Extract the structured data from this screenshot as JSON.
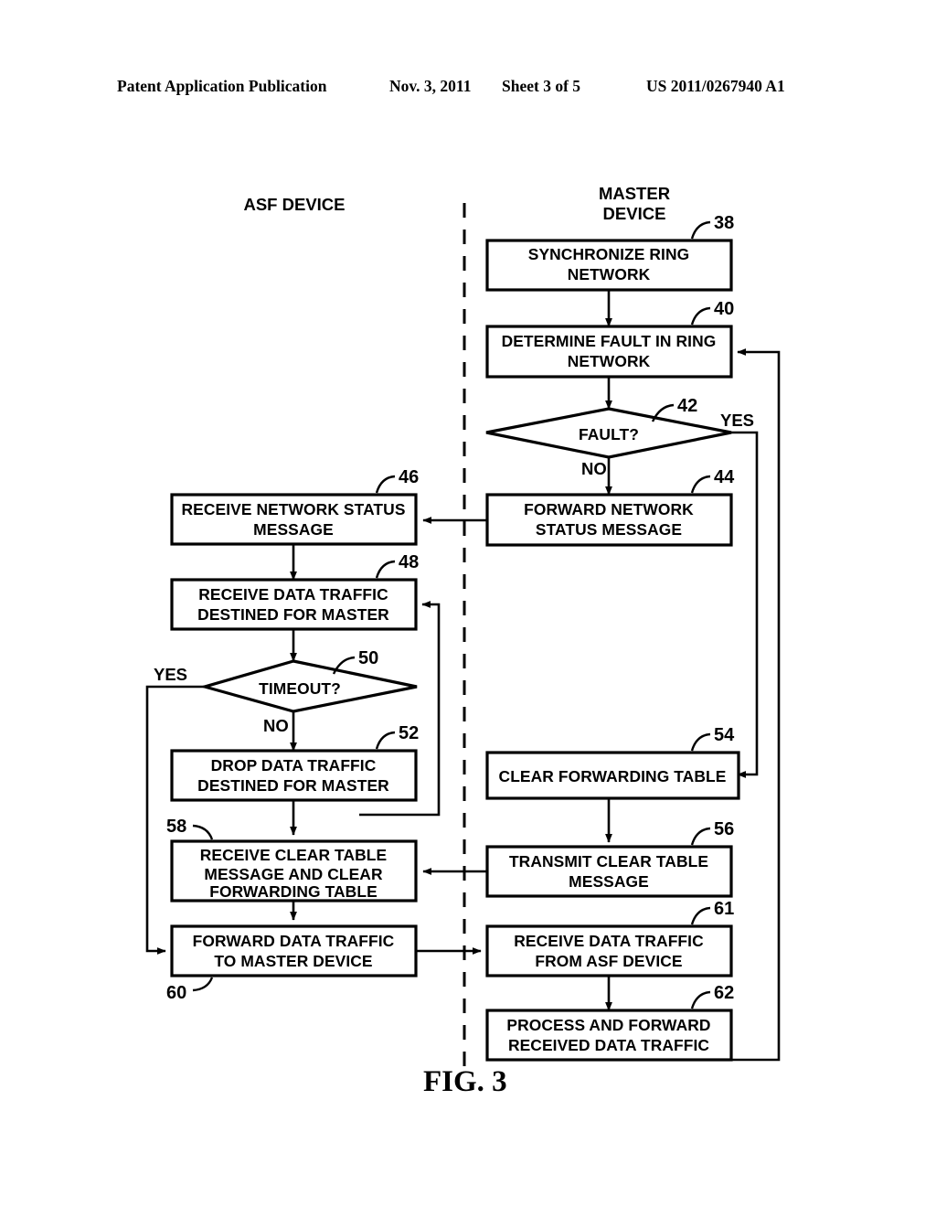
{
  "header": {
    "publication": "Patent Application Publication",
    "date": "Nov. 3, 2011",
    "sheet": "Sheet 3 of 5",
    "number": "US 2011/0267940 A1"
  },
  "figure": {
    "caption": "FIG. 3",
    "lanes": [
      {
        "id": "asf",
        "title": "ASF DEVICE"
      },
      {
        "id": "master",
        "title_line1": "MASTER",
        "title_line2": "DEVICE"
      }
    ],
    "nodes": [
      {
        "ref": "38",
        "lane": "master",
        "shape": "process",
        "lines": [
          "SYNCHRONIZE RING",
          "NETWORK"
        ]
      },
      {
        "ref": "40",
        "lane": "master",
        "shape": "process",
        "lines": [
          "DETERMINE FAULT IN RING",
          "NETWORK"
        ]
      },
      {
        "ref": "42",
        "lane": "master",
        "shape": "decision",
        "lines": [
          "FAULT?"
        ]
      },
      {
        "ref": "44",
        "lane": "master",
        "shape": "process",
        "lines": [
          "FORWARD NETWORK",
          "STATUS MESSAGE"
        ]
      },
      {
        "ref": "46",
        "lane": "asf",
        "shape": "process",
        "lines": [
          "RECEIVE NETWORK STATUS",
          "MESSAGE"
        ]
      },
      {
        "ref": "48",
        "lane": "asf",
        "shape": "process",
        "lines": [
          "RECEIVE DATA TRAFFIC",
          "DESTINED FOR MASTER"
        ]
      },
      {
        "ref": "50",
        "lane": "asf",
        "shape": "decision",
        "lines": [
          "TIMEOUT?"
        ]
      },
      {
        "ref": "52",
        "lane": "asf",
        "shape": "process",
        "lines": [
          "DROP DATA TRAFFIC",
          "DESTINED FOR MASTER"
        ]
      },
      {
        "ref": "54",
        "lane": "master",
        "shape": "process",
        "lines": [
          "CLEAR FORWARDING TABLE"
        ]
      },
      {
        "ref": "56",
        "lane": "master",
        "shape": "process",
        "lines": [
          "TRANSMIT CLEAR TABLE",
          "MESSAGE"
        ]
      },
      {
        "ref": "58",
        "lane": "asf",
        "shape": "process",
        "lines": [
          "RECEIVE CLEAR TABLE",
          "MESSAGE AND CLEAR",
          "FORWARDING TABLE"
        ]
      },
      {
        "ref": "60",
        "lane": "asf",
        "shape": "process",
        "lines": [
          "FORWARD DATA TRAFFIC",
          "TO MASTER DEVICE"
        ]
      },
      {
        "ref": "61",
        "lane": "master",
        "shape": "process",
        "lines": [
          "RECEIVE DATA TRAFFIC",
          "FROM ASF DEVICE"
        ]
      },
      {
        "ref": "62",
        "lane": "master",
        "shape": "process",
        "lines": [
          "PROCESS AND FORWARD",
          "RECEIVED DATA TRAFFIC"
        ]
      }
    ],
    "branch_labels": {
      "fault_yes": "YES",
      "fault_no": "NO",
      "timeout_yes": "YES",
      "timeout_no": "NO"
    }
  },
  "colors": {
    "ink": "#000000",
    "paper": "#ffffff"
  }
}
